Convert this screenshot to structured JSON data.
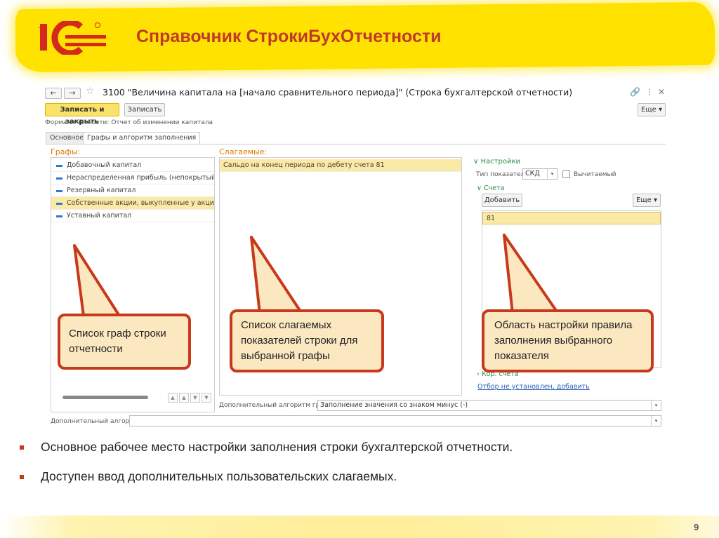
{
  "slide": {
    "title": "Справочник СтрокиБухОтчетности",
    "page_number": "9",
    "bullets": [
      "Основное рабочее место настройки заполнения строки бухгалтерской отчетности.",
      "Доступен ввод дополнительных пользовательских слагаемых."
    ]
  },
  "window": {
    "back_label": "←",
    "forward_label": "→",
    "title": "3100 \"Величина капитала на [начало сравнительного периода]\" (Строка бухгалтерской отчетности)",
    "save_close_label": "Записать и закрыть",
    "save_label": "Записать",
    "more_label": "Еще",
    "form_label": "Форма отчетности:",
    "form_value": "Отчет об изменении капитала",
    "tabs": [
      "Основное",
      "Графы и алгоритм заполнения"
    ]
  },
  "columns_panel": {
    "label": "Графы:",
    "items": [
      "Добавочный капитал",
      "Нераспределенная прибыль (непокрытый убыток)",
      "Резервный капитал",
      "Собственные акции, выкупленные у акционеров",
      "Уставный капитал"
    ],
    "selected_index": 3
  },
  "terms_panel": {
    "label": "Слагаемые:",
    "items": [
      "Сальдо на конец периода по дебету счета 81"
    ]
  },
  "settings_panel": {
    "label": "Настройки",
    "type_label": "Тип показателя:",
    "type_value": "СКД",
    "subtract_label": "Вычитаемый",
    "accounts_label": "Счета",
    "add_label": "Добавить",
    "more_label": "Еще",
    "accounts": [
      "81"
    ],
    "corr_label": "Кор. счета",
    "selection_link": "Отбор не установлен, добавить"
  },
  "additional": {
    "column_algo_label": "Дополнительный алгоритм графы:",
    "column_algo_value": "Заполнение значения со знаком минус (-)",
    "algo_label": "Дополнительный алгоритм:",
    "algo_value": ""
  },
  "callouts": {
    "columns": "Список граф строки отчетности",
    "terms": "Список слагаемых показателей строки для выбранной графы",
    "settings": "Область настройки правила заполнения выбранного показателя"
  },
  "colors": {
    "accent_yellow": "#ffe200",
    "title_red": "#c0392b",
    "callout_border": "#c8391c",
    "callout_fill": "#fbe8c0",
    "section_orange": "#e07a00"
  }
}
